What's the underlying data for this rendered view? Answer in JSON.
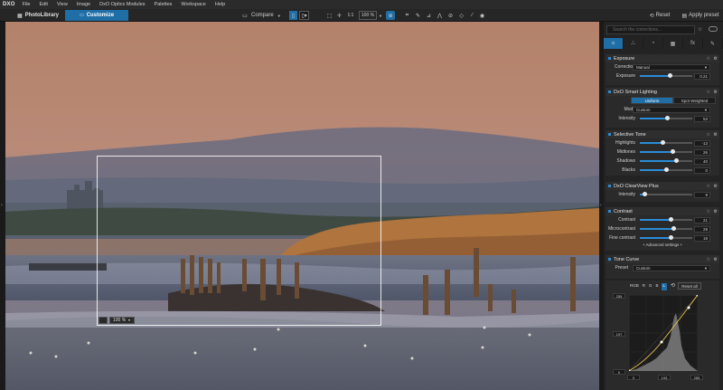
{
  "app": {
    "logo": "DXO",
    "menu": [
      "File",
      "Edit",
      "View",
      "Image",
      "DxO Optics Modules",
      "Palettes",
      "Workspace",
      "Help"
    ]
  },
  "toolbar": {
    "tabs": [
      "PhotoLibrary",
      "Customize"
    ],
    "active_tab": "Customize",
    "compare_label": "Compare",
    "zoom_one": "1:1",
    "zoom_value": "100 %",
    "reset_label": "Reset",
    "apply_preset_label": "Apply preset"
  },
  "viewer": {
    "loupe_zoom": "100 %"
  },
  "panel": {
    "search_placeholder": "Search the corrections...",
    "exposure": {
      "title": "Exposure",
      "correction_label": "Correction",
      "correction_value": "Manual",
      "exposure_label": "Exposure",
      "exposure_value": "0.21",
      "exposure_level": 0.58
    },
    "smart_lighting": {
      "title": "DxO Smart Lighting",
      "modes": [
        "Uniform",
        "Spot Weighted"
      ],
      "active_mode": "Uniform",
      "mode_label": "Mode",
      "mode_value": "Custom",
      "intensity_label": "Intensity",
      "intensity_value": "53",
      "intensity_level": 0.53
    },
    "selective_tone": {
      "title": "Selective Tone",
      "rows": [
        {
          "label": "Highlights",
          "value": "-13",
          "level": 0.44
        },
        {
          "label": "Midtones",
          "value": "26",
          "level": 0.63
        },
        {
          "label": "Shadows",
          "value": "40",
          "level": 0.7
        },
        {
          "label": "Blacks",
          "value": "0",
          "level": 0.5
        }
      ]
    },
    "clearview": {
      "title": "DxO ClearView Plus",
      "intensity_label": "Intensity",
      "intensity_value": "9",
      "intensity_level": 0.09
    },
    "contrast": {
      "title": "Contrast",
      "rows": [
        {
          "label": "Contrast",
          "value": "21",
          "level": 0.6
        },
        {
          "label": "Microcontrast",
          "value": "29",
          "level": 0.64
        },
        {
          "label": "Fine contrast",
          "value": "18",
          "level": 0.59
        }
      ],
      "advanced": "+ Advanced settings +"
    },
    "tone_curve": {
      "title": "Tone Curve",
      "preset_label": "Preset",
      "preset_value": "Custom",
      "channels": [
        "RGB",
        "R",
        "G",
        "B",
        "L"
      ],
      "active_channel": "L",
      "reset_all": "Reset all",
      "y_top": "255",
      "y_mid": "197",
      "y_bottom": "0",
      "x_left": "0",
      "x_mid": "193",
      "x_right": "255"
    }
  }
}
